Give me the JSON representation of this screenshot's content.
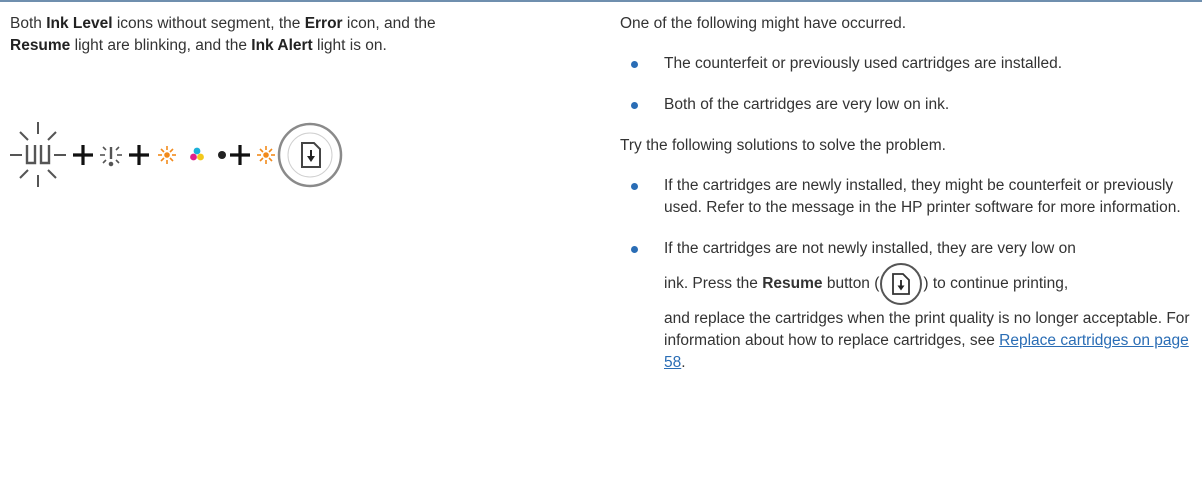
{
  "left": {
    "para": {
      "t1": "Both ",
      "b1": "Ink Level",
      "t2": " icons without segment, the ",
      "b2": "Error",
      "t3": " icon, and the",
      "b3": "Resume",
      "t4": " light are blinking, and the ",
      "b4": "Ink Alert",
      "t5": " light is on."
    },
    "icons": {
      "sequence": [
        "ink-level-blinking-icon",
        "plus",
        "error-blinking-icon",
        "plus",
        "ink-alert-on-icon",
        "color-cartridge-icon",
        "black-cartridge-icon",
        "plus",
        "resume-blinking-icon"
      ],
      "alert_color": "#f28a1c"
    }
  },
  "right": {
    "intro": "One of the following might have occurred.",
    "occurrences": [
      "The counterfeit or previously used cartridges are installed.",
      "Both of the cartridges are very low on ink."
    ],
    "solutions_intro": "Try the following solutions to solve the problem.",
    "solution1": "If the cartridges are newly installed, they might be counterfeit or previously used. Refer to the message in the HP printer software for more information.",
    "solution2": {
      "a": "If the cartridges are not newly installed, they are very low on",
      "b": "ink. Press the ",
      "bold": "Resume",
      "c": " button (",
      "d": ") to continue printing,",
      "e": "and replace the cartridges when the print quality is no longer acceptable. For information about how to replace cartridges, see ",
      "link": "Replace cartridges on page 58",
      "f": "."
    }
  }
}
